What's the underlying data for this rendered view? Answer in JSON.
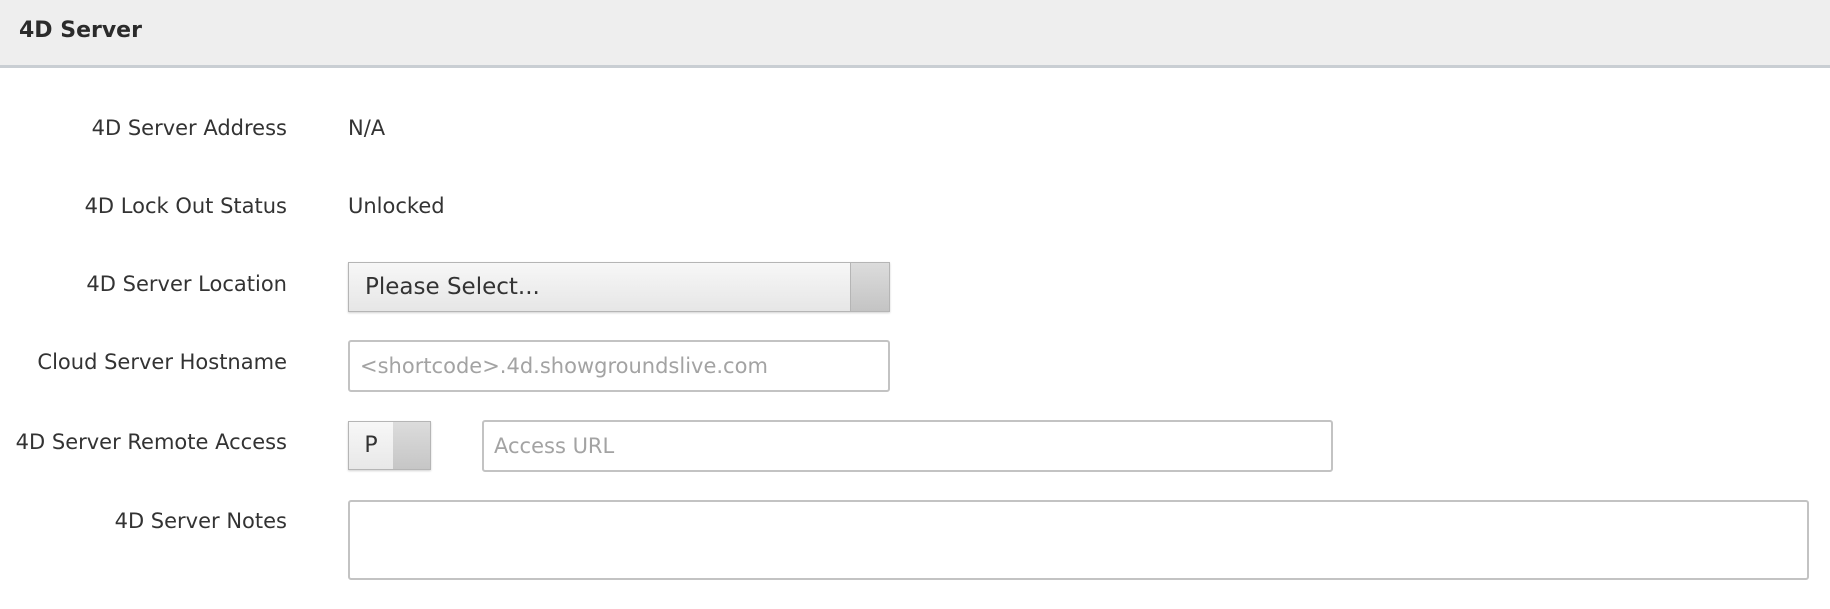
{
  "panel": {
    "title": "4D Server"
  },
  "fields": {
    "server_address": {
      "label": "4D Server Address",
      "value": "N/A"
    },
    "lock_out_status": {
      "label": "4D Lock Out Status",
      "value": "Unlocked"
    },
    "server_location": {
      "label": "4D Server Location",
      "selected": "Please Select..."
    },
    "cloud_hostname": {
      "label": "Cloud Server Hostname",
      "value": "",
      "placeholder": "<shortcode>.4d.showgroundslive.com"
    },
    "remote_access": {
      "label": "4D Server Remote Access",
      "toggle_text": "P",
      "url_value": "",
      "url_placeholder": "Access URL"
    },
    "notes": {
      "label": "4D Server Notes",
      "value": ""
    }
  }
}
